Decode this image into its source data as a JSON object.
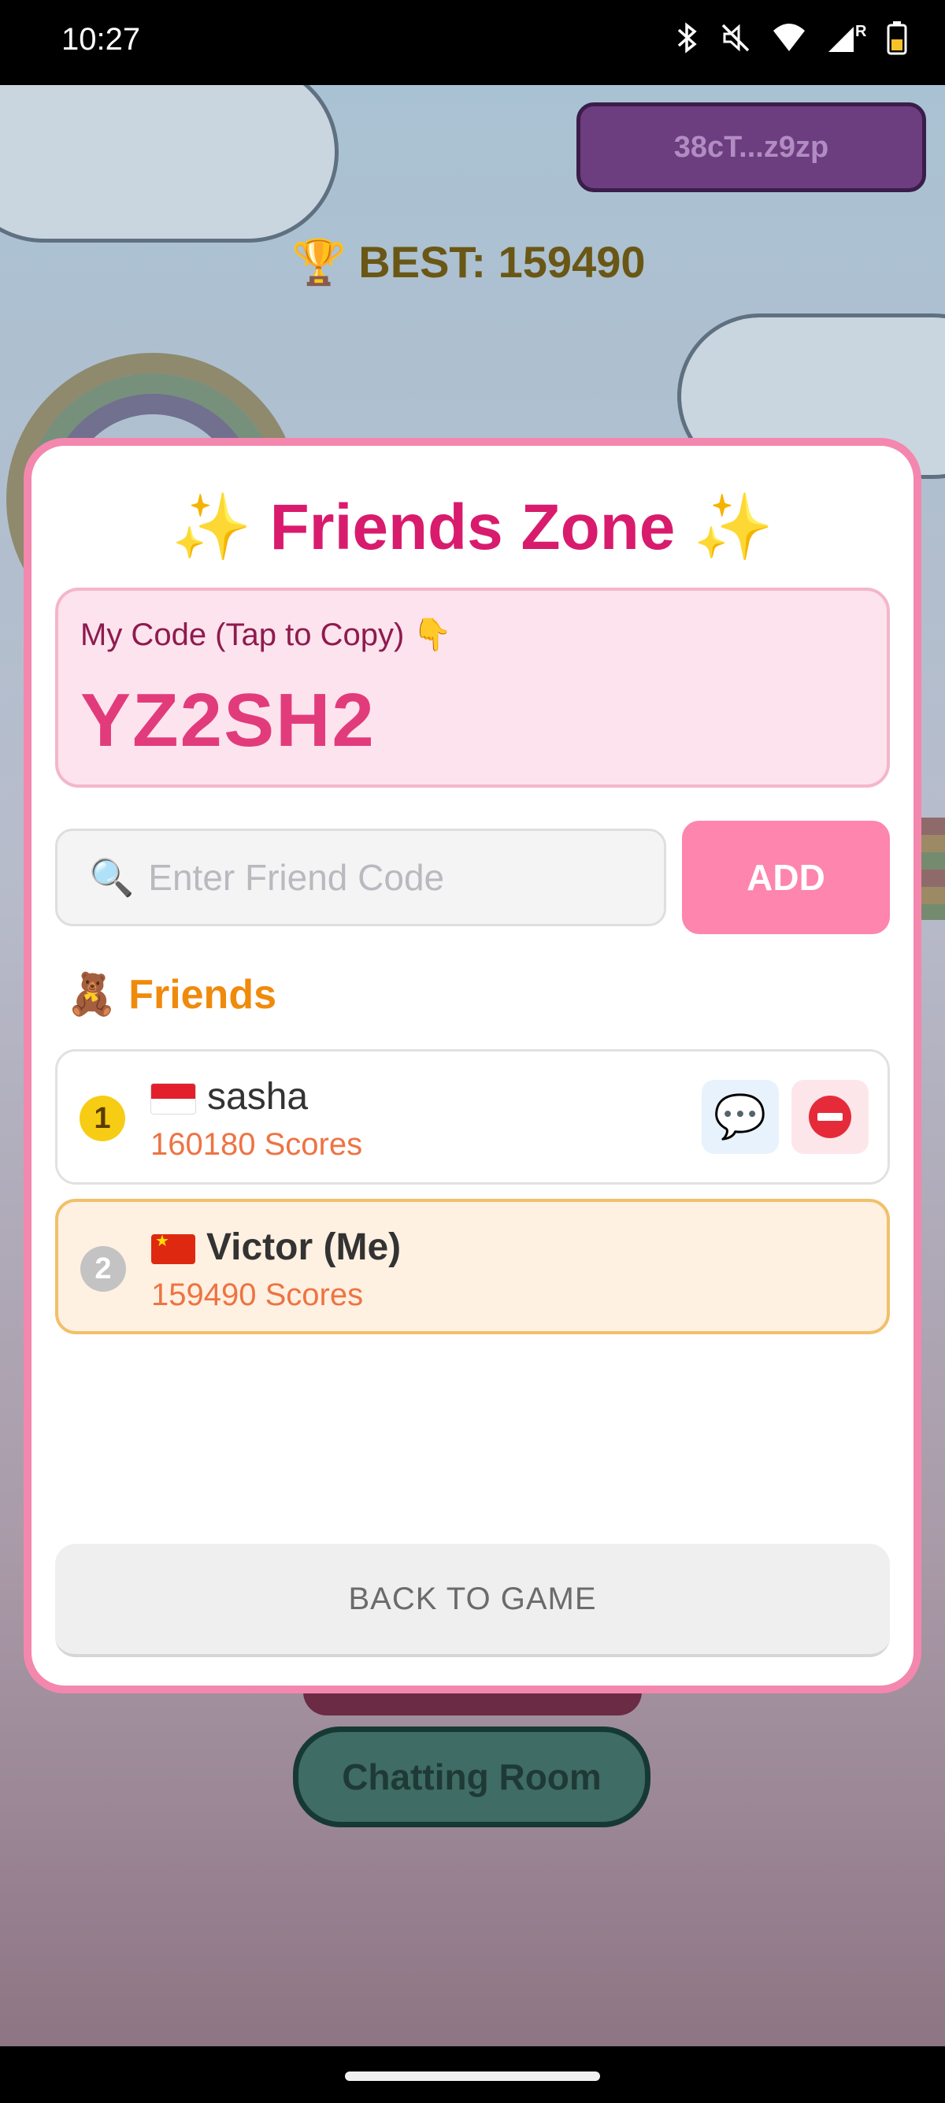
{
  "status_bar": {
    "time": "10:27",
    "icons": [
      "bluetooth-icon",
      "mute-icon",
      "wifi-icon",
      "signal-icon",
      "battery-icon"
    ],
    "signal_label": "R"
  },
  "game": {
    "wallet_label": "38cT...z9zp",
    "best_label": "🏆 BEST: 159490",
    "chat_room_label": "Chatting Room"
  },
  "modal": {
    "title": "✨ Friends Zone ✨",
    "my_code_label": "My Code (Tap to Copy) 👇",
    "my_code": "YZ2SH2",
    "search_icon": "🔍",
    "search_placeholder": "Enter Friend Code",
    "add_label": "ADD",
    "friends_header": "🧸 Friends",
    "friends": [
      {
        "rank": "1",
        "flag": "Indonesia",
        "name": "sasha",
        "score": "160180 Scores",
        "chat_icon": "💬"
      },
      {
        "rank": "2",
        "flag": "China",
        "name": "Victor (Me)",
        "score": "159490 Scores"
      }
    ],
    "back_label": "BACK TO GAME"
  },
  "colors": {
    "accent_pink": "#d81b6d",
    "modal_border": "#f487ad",
    "add_button": "#fe85ad",
    "score_text": "#ee7343",
    "friends_header": "#f08a0b"
  }
}
